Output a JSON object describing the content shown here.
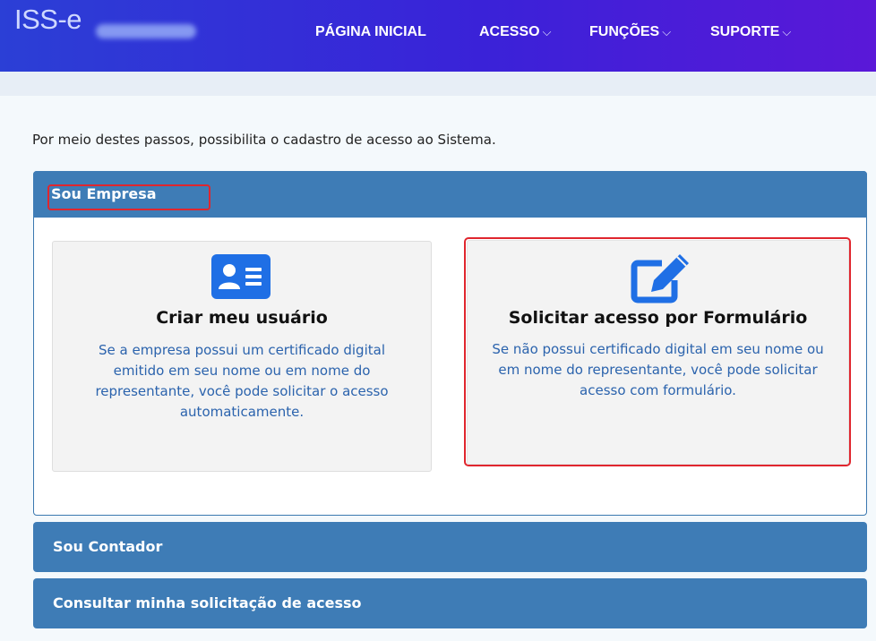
{
  "header": {
    "brand": "ISS-e",
    "nav": [
      {
        "label": "PÁGINA INICIAL",
        "dropdown": false
      },
      {
        "label": "ACESSO",
        "dropdown": true
      },
      {
        "label": "FUNÇÕES",
        "dropdown": true
      },
      {
        "label": "SUPORTE",
        "dropdown": true
      }
    ],
    "chevron": "⌵"
  },
  "intro": "Por meio destes passos, possibilita o cadastro de acesso ao Sistema.",
  "panels": {
    "empresa": {
      "title": "Sou Empresa",
      "cards": [
        {
          "icon": "id-card-icon",
          "title": "Criar meu usuário",
          "description": "Se a empresa possui um certificado digital emitido em seu nome ou em nome do representante, você pode solicitar o acesso automaticamente."
        },
        {
          "icon": "edit-icon",
          "title": "Solicitar acesso por Formulário",
          "description": "Se não possui certificado digital em seu nome ou em nome do representante, você pode solicitar acesso com formulário."
        }
      ]
    },
    "contador": {
      "title": "Sou Contador"
    },
    "consultar": {
      "title": "Consultar minha solicitação de acesso"
    }
  },
  "colors": {
    "accent": "#3e7cb6",
    "icon_blue": "#1f6fe5",
    "link_text": "#2b63ad",
    "highlight": "#e0262e"
  }
}
